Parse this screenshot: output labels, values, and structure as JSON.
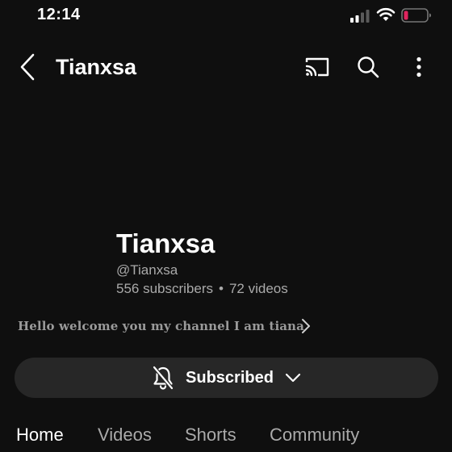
{
  "status_bar": {
    "time": "12:14"
  },
  "top_bar": {
    "title": "Tianxsa",
    "icons": [
      "back-icon",
      "cast-icon",
      "search-icon",
      "more-icon"
    ]
  },
  "channel": {
    "name": "Tianxsa",
    "handle": "@Tianxsa",
    "subscribers": "556 subscribers",
    "separator": "•",
    "videos": "72 videos",
    "description": "Hello welcome you my channel I am tiana"
  },
  "subscribe": {
    "label": "Subscribed"
  },
  "tabs": [
    "Home",
    "Videos",
    "Shorts",
    "Community"
  ],
  "colors": {
    "background": "#0f0f0f",
    "button": "#272727",
    "secondary_text": "#aaaaaa",
    "battery_low": "#e0245e"
  }
}
